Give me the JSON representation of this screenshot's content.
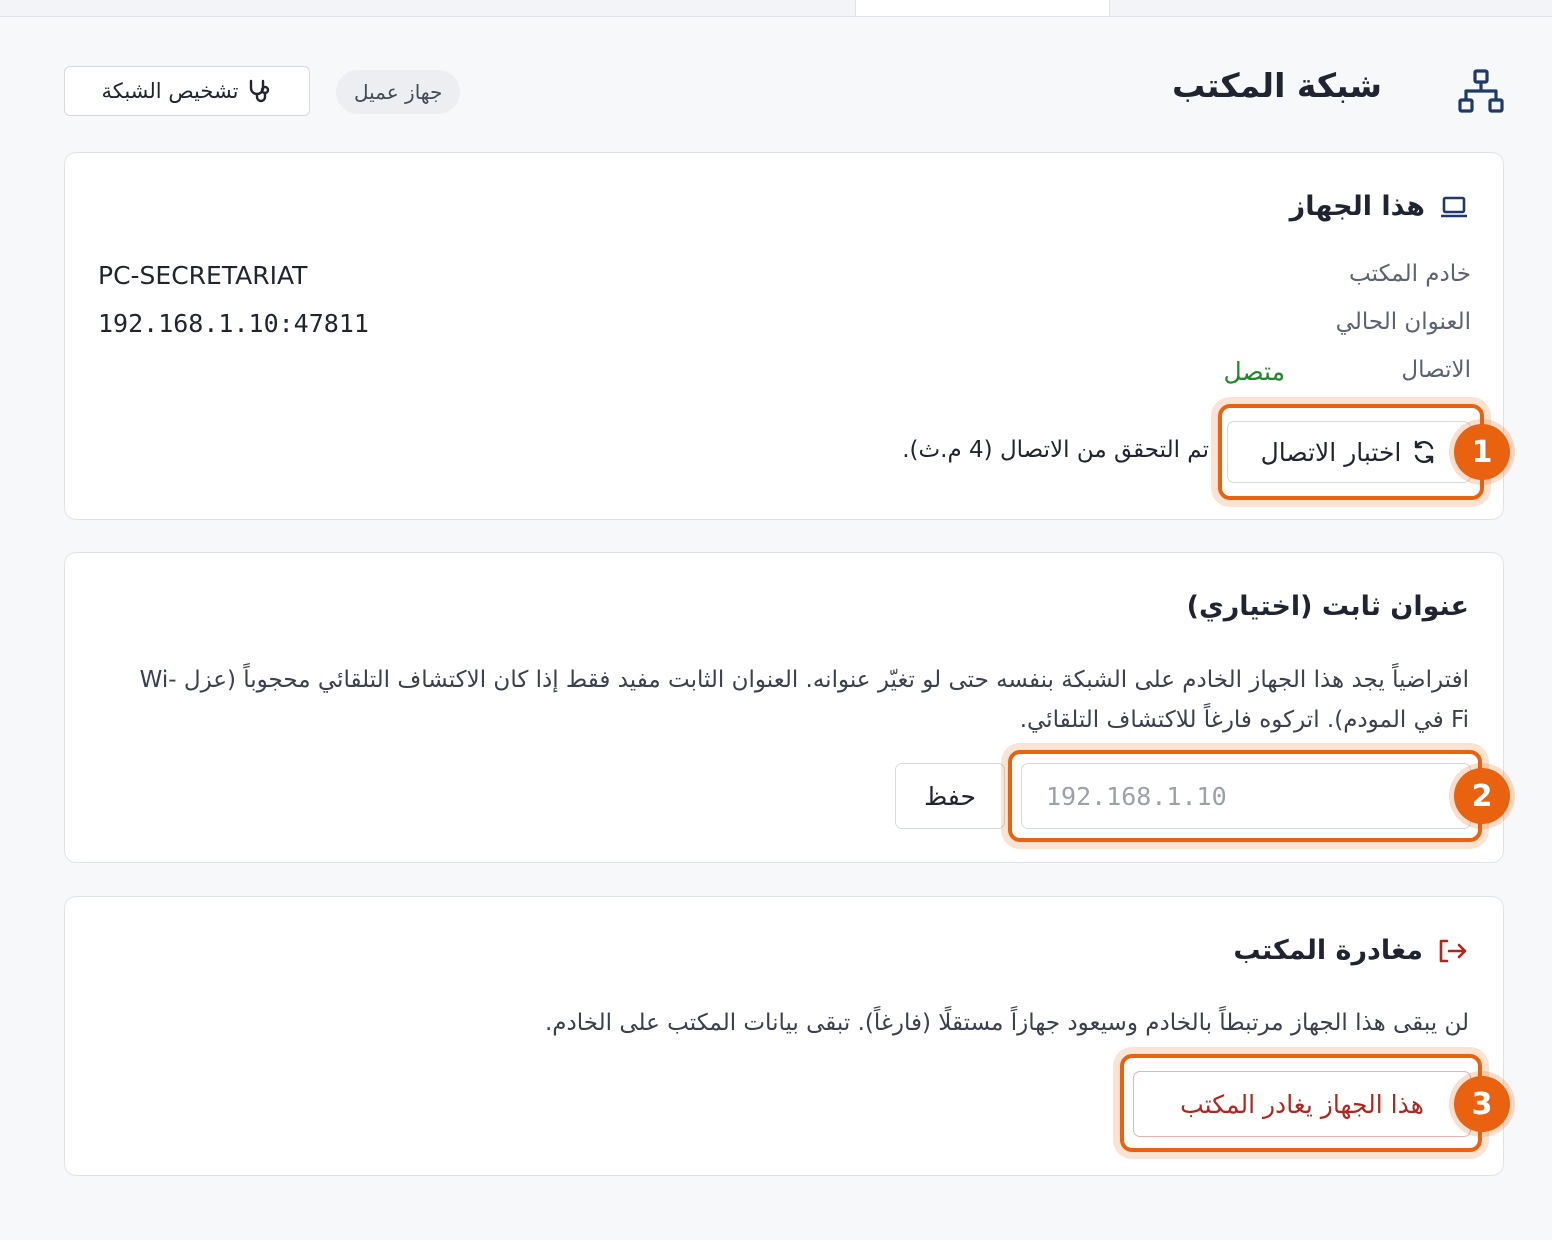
{
  "header": {
    "title": "شبكة المكتب",
    "badge": "جهاز عميل",
    "diagnose_label": "تشخيص الشبكة"
  },
  "device_card": {
    "title": "هذا الجهاز",
    "server_label": "خادم المكتب",
    "server_value": "PC-SECRETARIAT",
    "address_label": "العنوان الحالي",
    "address_value": "192.168.1.10:47811",
    "connection_label": "الاتصال",
    "connection_value": "متصل",
    "test_button": "اختبار الاتصال",
    "test_result": "تم التحقق من الاتصال (4 م.ث)."
  },
  "static_card": {
    "title": "عنوان ثابت (اختياري)",
    "description": "افتراضياً يجد هذا الجهاز الخادم على الشبكة بنفسه حتى لو تغيّر عنوانه. العنوان الثابت مفيد فقط إذا كان الاكتشاف التلقائي محجوباً (عزل Wi-Fi في المودم). اتركوه فارغاً للاكتشاف التلقائي.",
    "input_placeholder": "192.168.1.10",
    "input_value": "",
    "save_button": "حفظ"
  },
  "leave_card": {
    "title": "مغادرة المكتب",
    "description": "لن يبقى هذا الجهاز مرتبطاً بالخادم وسيعود جهازاً مستقلًا (فارغاً). تبقى بيانات المكتب على الخادم.",
    "leave_button": "هذا الجهاز يغادر المكتب"
  },
  "annotations": [
    "1",
    "2",
    "3"
  ],
  "colors": {
    "accent": "#e8620f",
    "icon_blue": "#1f3a68",
    "success": "#1e8a2c",
    "danger": "#b3261e"
  },
  "icons": {
    "header": "network-icon",
    "diagnose": "stethoscope-icon",
    "device": "laptop-icon",
    "test": "refresh-icon",
    "leave": "logout-icon"
  }
}
